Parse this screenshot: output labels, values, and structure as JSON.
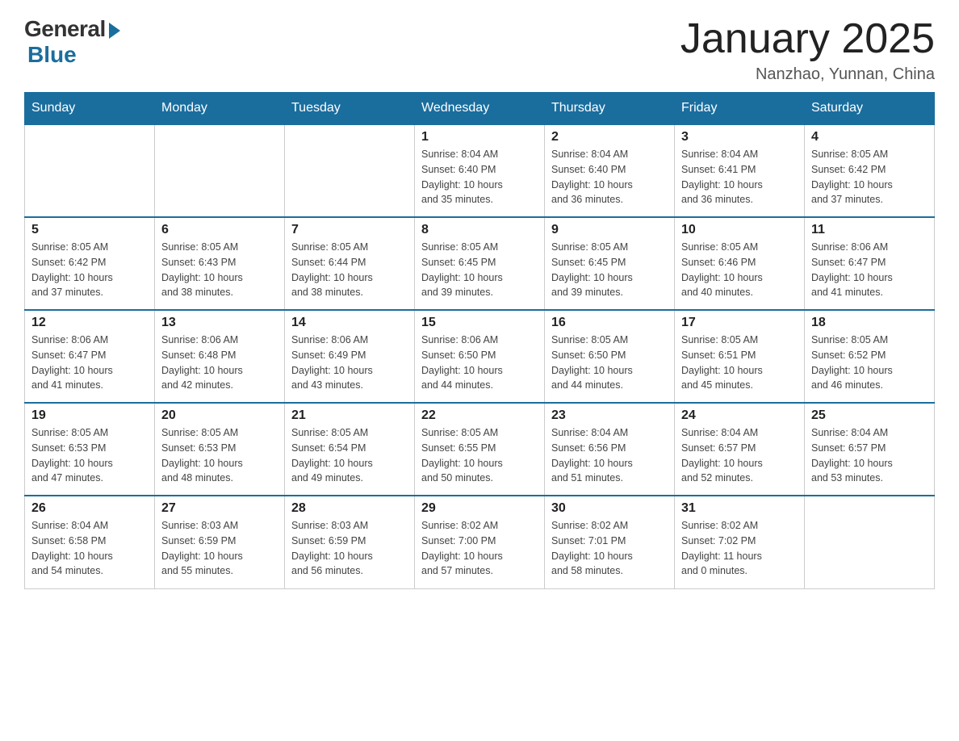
{
  "header": {
    "logo_general": "General",
    "logo_blue": "Blue",
    "title": "January 2025",
    "location": "Nanzhao, Yunnan, China"
  },
  "weekdays": [
    "Sunday",
    "Monday",
    "Tuesday",
    "Wednesday",
    "Thursday",
    "Friday",
    "Saturday"
  ],
  "weeks": [
    [
      {
        "day": "",
        "info": ""
      },
      {
        "day": "",
        "info": ""
      },
      {
        "day": "",
        "info": ""
      },
      {
        "day": "1",
        "info": "Sunrise: 8:04 AM\nSunset: 6:40 PM\nDaylight: 10 hours\nand 35 minutes."
      },
      {
        "day": "2",
        "info": "Sunrise: 8:04 AM\nSunset: 6:40 PM\nDaylight: 10 hours\nand 36 minutes."
      },
      {
        "day": "3",
        "info": "Sunrise: 8:04 AM\nSunset: 6:41 PM\nDaylight: 10 hours\nand 36 minutes."
      },
      {
        "day": "4",
        "info": "Sunrise: 8:05 AM\nSunset: 6:42 PM\nDaylight: 10 hours\nand 37 minutes."
      }
    ],
    [
      {
        "day": "5",
        "info": "Sunrise: 8:05 AM\nSunset: 6:42 PM\nDaylight: 10 hours\nand 37 minutes."
      },
      {
        "day": "6",
        "info": "Sunrise: 8:05 AM\nSunset: 6:43 PM\nDaylight: 10 hours\nand 38 minutes."
      },
      {
        "day": "7",
        "info": "Sunrise: 8:05 AM\nSunset: 6:44 PM\nDaylight: 10 hours\nand 38 minutes."
      },
      {
        "day": "8",
        "info": "Sunrise: 8:05 AM\nSunset: 6:45 PM\nDaylight: 10 hours\nand 39 minutes."
      },
      {
        "day": "9",
        "info": "Sunrise: 8:05 AM\nSunset: 6:45 PM\nDaylight: 10 hours\nand 39 minutes."
      },
      {
        "day": "10",
        "info": "Sunrise: 8:05 AM\nSunset: 6:46 PM\nDaylight: 10 hours\nand 40 minutes."
      },
      {
        "day": "11",
        "info": "Sunrise: 8:06 AM\nSunset: 6:47 PM\nDaylight: 10 hours\nand 41 minutes."
      }
    ],
    [
      {
        "day": "12",
        "info": "Sunrise: 8:06 AM\nSunset: 6:47 PM\nDaylight: 10 hours\nand 41 minutes."
      },
      {
        "day": "13",
        "info": "Sunrise: 8:06 AM\nSunset: 6:48 PM\nDaylight: 10 hours\nand 42 minutes."
      },
      {
        "day": "14",
        "info": "Sunrise: 8:06 AM\nSunset: 6:49 PM\nDaylight: 10 hours\nand 43 minutes."
      },
      {
        "day": "15",
        "info": "Sunrise: 8:06 AM\nSunset: 6:50 PM\nDaylight: 10 hours\nand 44 minutes."
      },
      {
        "day": "16",
        "info": "Sunrise: 8:05 AM\nSunset: 6:50 PM\nDaylight: 10 hours\nand 44 minutes."
      },
      {
        "day": "17",
        "info": "Sunrise: 8:05 AM\nSunset: 6:51 PM\nDaylight: 10 hours\nand 45 minutes."
      },
      {
        "day": "18",
        "info": "Sunrise: 8:05 AM\nSunset: 6:52 PM\nDaylight: 10 hours\nand 46 minutes."
      }
    ],
    [
      {
        "day": "19",
        "info": "Sunrise: 8:05 AM\nSunset: 6:53 PM\nDaylight: 10 hours\nand 47 minutes."
      },
      {
        "day": "20",
        "info": "Sunrise: 8:05 AM\nSunset: 6:53 PM\nDaylight: 10 hours\nand 48 minutes."
      },
      {
        "day": "21",
        "info": "Sunrise: 8:05 AM\nSunset: 6:54 PM\nDaylight: 10 hours\nand 49 minutes."
      },
      {
        "day": "22",
        "info": "Sunrise: 8:05 AM\nSunset: 6:55 PM\nDaylight: 10 hours\nand 50 minutes."
      },
      {
        "day": "23",
        "info": "Sunrise: 8:04 AM\nSunset: 6:56 PM\nDaylight: 10 hours\nand 51 minutes."
      },
      {
        "day": "24",
        "info": "Sunrise: 8:04 AM\nSunset: 6:57 PM\nDaylight: 10 hours\nand 52 minutes."
      },
      {
        "day": "25",
        "info": "Sunrise: 8:04 AM\nSunset: 6:57 PM\nDaylight: 10 hours\nand 53 minutes."
      }
    ],
    [
      {
        "day": "26",
        "info": "Sunrise: 8:04 AM\nSunset: 6:58 PM\nDaylight: 10 hours\nand 54 minutes."
      },
      {
        "day": "27",
        "info": "Sunrise: 8:03 AM\nSunset: 6:59 PM\nDaylight: 10 hours\nand 55 minutes."
      },
      {
        "day": "28",
        "info": "Sunrise: 8:03 AM\nSunset: 6:59 PM\nDaylight: 10 hours\nand 56 minutes."
      },
      {
        "day": "29",
        "info": "Sunrise: 8:02 AM\nSunset: 7:00 PM\nDaylight: 10 hours\nand 57 minutes."
      },
      {
        "day": "30",
        "info": "Sunrise: 8:02 AM\nSunset: 7:01 PM\nDaylight: 10 hours\nand 58 minutes."
      },
      {
        "day": "31",
        "info": "Sunrise: 8:02 AM\nSunset: 7:02 PM\nDaylight: 11 hours\nand 0 minutes."
      },
      {
        "day": "",
        "info": ""
      }
    ]
  ]
}
